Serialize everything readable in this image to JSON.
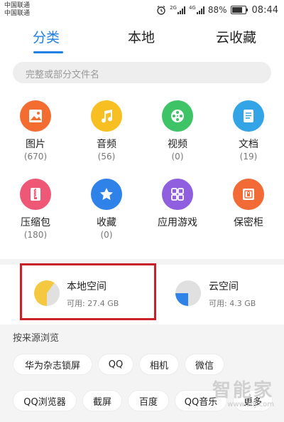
{
  "status_bar": {
    "carrier_1": "中国联通",
    "carrier_2": "中国联通",
    "net_1": "2G",
    "net_2": "4G",
    "battery": "88%",
    "time": "08:44",
    "battery_level": 0.88,
    "icons": [
      "alarm-icon",
      "signal-icon",
      "signal-icon",
      "battery-icon"
    ]
  },
  "tabs": [
    {
      "label": "分类",
      "active": true
    },
    {
      "label": "本地",
      "active": false
    },
    {
      "label": "云收藏",
      "active": false
    }
  ],
  "search": {
    "placeholder": "完整或部分文件名"
  },
  "categories": [
    {
      "label": "图片",
      "count": "(670)",
      "icon": "image-icon",
      "color": "#f36d31"
    },
    {
      "label": "音频",
      "count": "(56)",
      "icon": "music-icon",
      "color": "#f7bf22"
    },
    {
      "label": "视频",
      "count": "(0)",
      "icon": "film-reel-icon",
      "color": "#3ec367"
    },
    {
      "label": "文档",
      "count": "(19)",
      "icon": "document-icon",
      "color": "#33a4e6"
    },
    {
      "label": "压缩包",
      "count": "(180)",
      "icon": "zip-icon",
      "color": "#ef5776"
    },
    {
      "label": "收藏",
      "count": "(0)",
      "icon": "star-icon",
      "color": "#2f82e8"
    },
    {
      "label": "应用游戏",
      "count": "",
      "icon": "apps-grid-icon",
      "color": "#8f5fe0"
    },
    {
      "label": "保密柜",
      "count": "",
      "icon": "safe-icon",
      "color": "#f26a35"
    }
  ],
  "storage": {
    "local": {
      "title": "本地空间",
      "sub": "可用: 27.4 GB",
      "used_fraction": 0.6
    },
    "cloud": {
      "title": "云空间",
      "sub": "可用: 4.3 GB",
      "used_fraction": 0.25
    }
  },
  "colors": {
    "accent": "#1f7fe5",
    "local_pie": "#f5c842",
    "cloud_pie": "#2f82e8",
    "highlight": "#c9202a"
  },
  "source": {
    "title": "按来源浏览",
    "chips": [
      "华为杂志锁屏",
      "QQ",
      "相机",
      "微信",
      "QQ浏览器",
      "截屏",
      "百度",
      "QQ音乐",
      "更多"
    ]
  },
  "watermark": {
    "big": "智能家",
    "small": "www.znj.com"
  }
}
